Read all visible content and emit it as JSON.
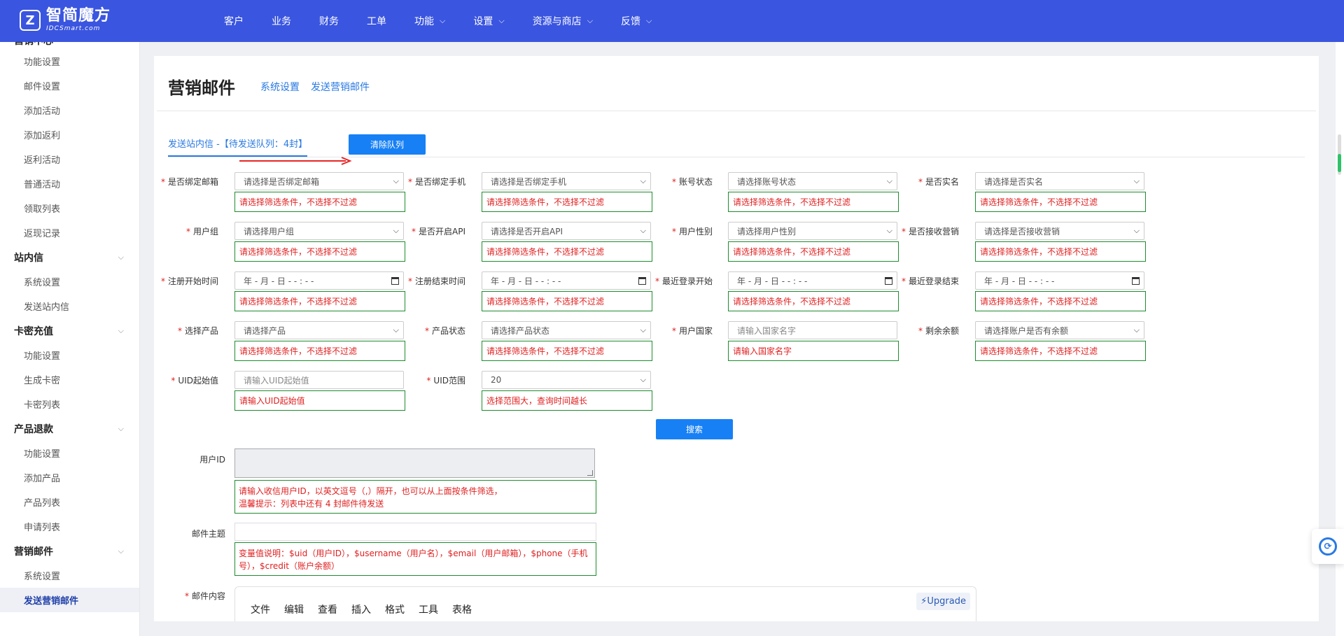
{
  "brand": {
    "name_cn": "智简魔方",
    "name_en": "IDCSmart.com",
    "mark": "Z"
  },
  "nav": [
    {
      "label": "客户",
      "dropdown": false
    },
    {
      "label": "业务",
      "dropdown": false
    },
    {
      "label": "财务",
      "dropdown": false
    },
    {
      "label": "工单",
      "dropdown": false
    },
    {
      "label": "功能",
      "dropdown": true
    },
    {
      "label": "设置",
      "dropdown": true
    },
    {
      "label": "资源与商店",
      "dropdown": true
    },
    {
      "label": "反馈",
      "dropdown": true
    }
  ],
  "sidebar": {
    "items": [
      {
        "label": "功能设置"
      },
      {
        "label": "邮件设置"
      },
      {
        "label": "添加活动"
      },
      {
        "label": "添加返利"
      },
      {
        "label": "返利活动"
      },
      {
        "label": "普通活动"
      },
      {
        "label": "领取列表"
      },
      {
        "label": "返现记录"
      },
      {
        "label": "站内信"
      },
      {
        "label": "系统设置"
      },
      {
        "label": "发送站内信"
      },
      {
        "label": "卡密充值"
      },
      {
        "label": "功能设置"
      },
      {
        "label": "生成卡密"
      },
      {
        "label": "卡密列表"
      },
      {
        "label": "产品退款"
      },
      {
        "label": "功能设置"
      },
      {
        "label": "添加产品"
      },
      {
        "label": "产品列表"
      },
      {
        "label": "申请列表"
      },
      {
        "label": "营销邮件"
      },
      {
        "label": "系统设置"
      },
      {
        "label": "发送营销邮件"
      }
    ]
  },
  "page": {
    "title": "营销邮件",
    "crumbs": [
      "系统设置",
      "发送营销邮件"
    ],
    "tab": "发送站内信 -【待发送队列：4封】",
    "clear_button": "清除队列",
    "search_button": "搜索"
  },
  "form": {
    "fields": [
      {
        "label": "是否绑定邮箱",
        "kind": "select",
        "value": "请选择是否绑定邮箱",
        "hint": "请选择筛选条件，不选择不过滤"
      },
      {
        "label": "是否绑定手机",
        "kind": "select",
        "value": "请选择是否绑定手机",
        "hint": "请选择筛选条件，不选择不过滤"
      },
      {
        "label": "账号状态",
        "kind": "select",
        "value": "请选择账号状态",
        "hint": "请选择筛选条件，不选择不过滤"
      },
      {
        "label": "是否实名",
        "kind": "select",
        "value": "请选择是否实名",
        "hint": "请选择筛选条件，不选择不过滤"
      },
      {
        "label": "用户组",
        "kind": "select",
        "value": "请选择用户组",
        "hint": "请选择筛选条件，不选择不过滤"
      },
      {
        "label": "是否开启API",
        "kind": "select",
        "value": "请选择是否开启API",
        "hint": "请选择筛选条件，不选择不过滤"
      },
      {
        "label": "用户性别",
        "kind": "select",
        "value": "请选择用户性别",
        "hint": "请选择筛选条件，不选择不过滤"
      },
      {
        "label": "是否接收营销",
        "kind": "select",
        "value": "请选择是否接收营销",
        "hint": "请选择筛选条件，不选择不过滤"
      },
      {
        "label": "注册开始时间",
        "kind": "date",
        "value": "年 - 月 - 日  - - : - -",
        "hint": "请选择筛选条件，不选择不过滤"
      },
      {
        "label": "注册结束时间",
        "kind": "date",
        "value": "年 - 月 - 日  - - : - -",
        "hint": "请选择筛选条件，不选择不过滤"
      },
      {
        "label": "最近登录开始",
        "kind": "date",
        "value": "年 - 月 - 日  - - : - -",
        "hint": "请选择筛选条件，不选择不过滤"
      },
      {
        "label": "最近登录结束",
        "kind": "date",
        "value": "年 - 月 - 日  - - : - -",
        "hint": "请选择筛选条件，不选择不过滤"
      },
      {
        "label": "选择产品",
        "kind": "select",
        "value": "请选择产品",
        "hint": "请选择筛选条件，不选择不过滤"
      },
      {
        "label": "产品状态",
        "kind": "select",
        "value": "请选择产品状态",
        "hint": "请选择筛选条件，不选择不过滤"
      },
      {
        "label": "用户国家",
        "kind": "input",
        "value": "请输入国家名字",
        "hint": "请输入国家名字"
      },
      {
        "label": "剩余余额",
        "kind": "select",
        "value": "请选择账户是否有余额",
        "hint": "请选择筛选条件，不选择不过滤"
      },
      {
        "label": "UID起始值",
        "kind": "input",
        "value": "请输入UID起始值",
        "hint": "请输入UID起始值"
      },
      {
        "label": "UID范围",
        "kind": "select",
        "value": "20",
        "hint": "选择范围大，查询时间越长"
      }
    ],
    "user_id": {
      "label": "用户ID",
      "hint_line1": "请输入收信用户ID，以英文逗号（,）隔开，也可以从上面按条件筛选，",
      "hint_line2": "温馨提示：列表中还有 4 封邮件待发送"
    },
    "subject": {
      "label": "邮件主题",
      "hint_line1": "变量值说明：$uid（用户ID），$username（用户名），$email（用户邮箱），$phone（手机",
      "hint_line2": "号），$credit（账户余额）"
    },
    "content": {
      "label": "邮件内容",
      "menu": [
        "文件",
        "编辑",
        "查看",
        "插入",
        "格式",
        "工具",
        "表格"
      ],
      "upgrade": "⚡Upgrade"
    }
  }
}
